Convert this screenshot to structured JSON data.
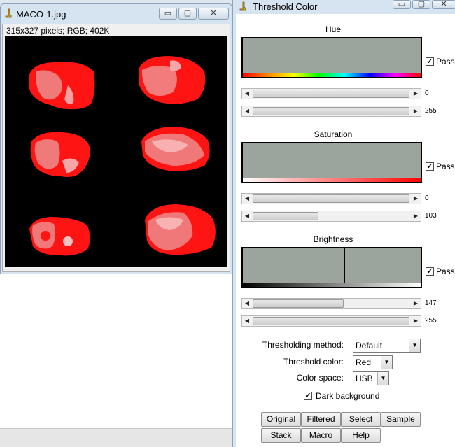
{
  "image_window": {
    "title": "MACO-1.jpg",
    "info": "315x327 pixels; RGB; 402K"
  },
  "threshold_window": {
    "title": "Threshold Color",
    "hue": {
      "title": "Hue",
      "pass_label": "Pass",
      "pass_checked": true,
      "min": 0,
      "max": 255,
      "min_label": "0",
      "max_label": "255"
    },
    "saturation": {
      "title": "Saturation",
      "pass_label": "Pass",
      "pass_checked": true,
      "min": 0,
      "max": 103,
      "min_label": "0",
      "max_label": "103"
    },
    "brightness": {
      "title": "Brightness",
      "pass_label": "Pass",
      "pass_checked": true,
      "min": 147,
      "max": 255,
      "min_label": "147",
      "max_label": "255"
    },
    "method": {
      "label": "Thresholding method:",
      "value": "Default"
    },
    "color": {
      "label": "Threshold color:",
      "value": "Red"
    },
    "space": {
      "label": "Color space:",
      "value": "HSB"
    },
    "dark_background": {
      "label": "Dark background",
      "checked": true
    },
    "buttons": [
      "Original",
      "Filtered",
      "Select",
      "Sample",
      "Stack",
      "Macro",
      "Help"
    ]
  },
  "window_controls": {
    "minimize": "▭",
    "maximize": "▢",
    "close": "✕"
  },
  "colors": {
    "histogram_bg": "#9ca59d",
    "tissue_red": "#ff1010",
    "tissue_pink": "#f58a8a",
    "canvas_bg": "#000000",
    "titlebar": "#d6e3f0"
  }
}
